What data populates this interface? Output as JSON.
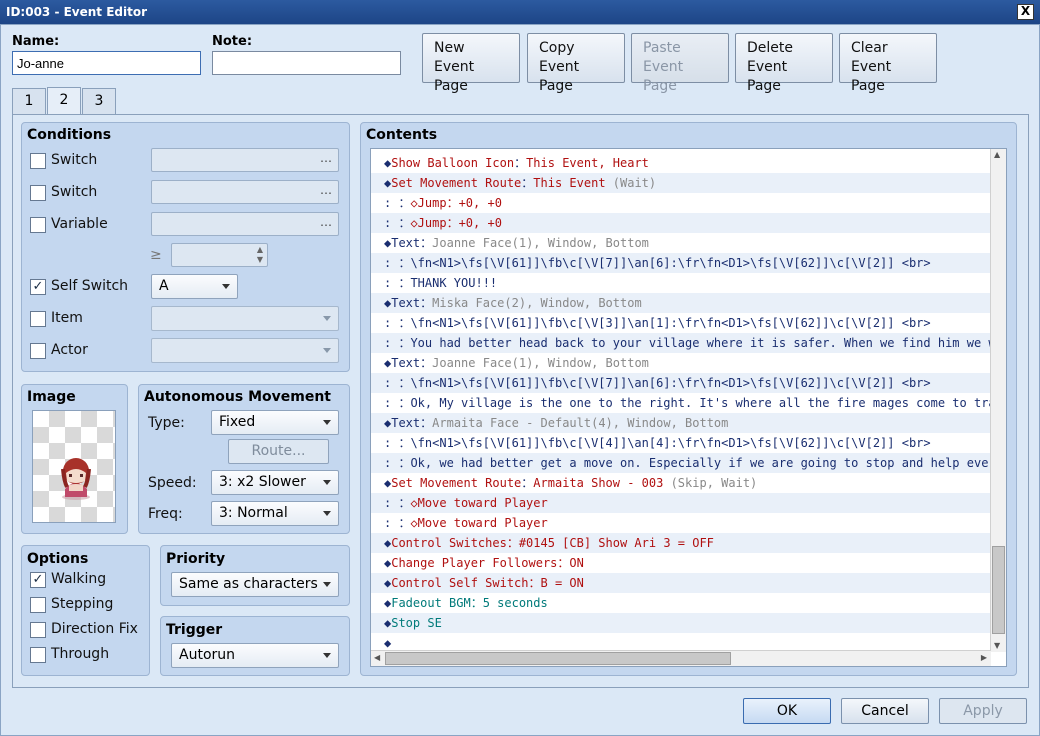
{
  "window": {
    "title": "ID:003 - Event Editor",
    "close": "X"
  },
  "header": {
    "name_label": "Name:",
    "name_value": "Jo-anne",
    "note_label": "Note:",
    "note_value": ""
  },
  "toolbar": [
    {
      "line1": "New",
      "line2": "Event Page",
      "enabled": true
    },
    {
      "line1": "Copy",
      "line2": "Event Page",
      "enabled": true
    },
    {
      "line1": "Paste",
      "line2": "Event Page",
      "enabled": false
    },
    {
      "line1": "Delete",
      "line2": "Event Page",
      "enabled": true
    },
    {
      "line1": "Clear",
      "line2": "Event Page",
      "enabled": true
    }
  ],
  "tabs": [
    "1",
    "2",
    "3"
  ],
  "active_tab": "2",
  "conditions": {
    "title": "Conditions",
    "switch1": {
      "label": "Switch",
      "checked": false,
      "value": "…"
    },
    "switch2": {
      "label": "Switch",
      "checked": false,
      "value": "…"
    },
    "variable": {
      "label": "Variable",
      "checked": false,
      "value": "…",
      "op": "≥"
    },
    "self_switch": {
      "label": "Self Switch",
      "checked": true,
      "value": "A"
    },
    "item": {
      "label": "Item",
      "checked": false
    },
    "actor": {
      "label": "Actor",
      "checked": false
    }
  },
  "image": {
    "title": "Image"
  },
  "movement": {
    "title": "Autonomous Movement",
    "type_label": "Type:",
    "type_value": "Fixed",
    "route_label": "Route...",
    "speed_label": "Speed:",
    "speed_value": "3: x2 Slower",
    "freq_label": "Freq:",
    "freq_value": "3: Normal"
  },
  "options": {
    "title": "Options",
    "items": [
      {
        "label": "Walking",
        "checked": true
      },
      {
        "label": "Stepping",
        "checked": false
      },
      {
        "label": "Direction Fix",
        "checked": false
      },
      {
        "label": "Through",
        "checked": false
      }
    ]
  },
  "priority": {
    "title": "Priority",
    "value": "Same as characters"
  },
  "trigger": {
    "title": "Trigger",
    "value": "Autorun"
  },
  "contents": {
    "title": "Contents",
    "rows": [
      {
        "segs": [
          {
            "t": "◆",
            "c": "navy"
          },
          {
            "t": "Show Balloon Icon",
            "c": "red"
          },
          {
            "t": "：",
            "c": "navy"
          },
          {
            "t": "This Event, Heart",
            "c": "red"
          }
        ]
      },
      {
        "segs": [
          {
            "t": "◆",
            "c": "navy"
          },
          {
            "t": "Set Movement Route",
            "c": "red"
          },
          {
            "t": "：",
            "c": "navy"
          },
          {
            "t": "This Event ",
            "c": "red"
          },
          {
            "t": "(Wait)",
            "c": "gray"
          }
        ]
      },
      {
        "segs": [
          {
            "t": ":                    ：",
            "c": "navy"
          },
          {
            "t": "◇Jump：+0, +0",
            "c": "red"
          }
        ]
      },
      {
        "segs": [
          {
            "t": ":                    ：",
            "c": "navy"
          },
          {
            "t": "◇Jump：+0, +0",
            "c": "red"
          }
        ]
      },
      {
        "segs": [
          {
            "t": "◆",
            "c": "navy"
          },
          {
            "t": "Text",
            "c": "navy"
          },
          {
            "t": "：",
            "c": "navy"
          },
          {
            "t": "Joanne Face(1), Window, Bottom",
            "c": "gray"
          }
        ]
      },
      {
        "segs": [
          {
            "t": ":     ：\\fn<N1>\\fs[\\V[61]]\\fb\\c[\\V[7]]\\an[6]:\\fr\\fn<D1>\\fs[\\V[62]]\\c[\\V[2]] <br>",
            "c": "navy"
          }
        ]
      },
      {
        "segs": [
          {
            "t": ":     ：THANK YOU!!!",
            "c": "navy"
          }
        ]
      },
      {
        "segs": [
          {
            "t": "◆",
            "c": "navy"
          },
          {
            "t": "Text",
            "c": "navy"
          },
          {
            "t": "：",
            "c": "navy"
          },
          {
            "t": "Miska Face(2), Window, Bottom",
            "c": "gray"
          }
        ]
      },
      {
        "segs": [
          {
            "t": ":     ：\\fn<N1>\\fs[\\V[61]]\\fb\\c[\\V[3]]\\an[1]:\\fr\\fn<D1>\\fs[\\V[62]]\\c[\\V[2]] <br>",
            "c": "navy"
          }
        ]
      },
      {
        "segs": [
          {
            "t": ":     ：You had better head back to your village where it is safer. When we find him we wi",
            "c": "navy"
          }
        ]
      },
      {
        "segs": [
          {
            "t": "◆",
            "c": "navy"
          },
          {
            "t": "Text",
            "c": "navy"
          },
          {
            "t": "：",
            "c": "navy"
          },
          {
            "t": "Joanne Face(1), Window, Bottom",
            "c": "gray"
          }
        ]
      },
      {
        "segs": [
          {
            "t": ":     ：\\fn<N1>\\fs[\\V[61]]\\fb\\c[\\V[7]]\\an[6]:\\fr\\fn<D1>\\fs[\\V[62]]\\c[\\V[2]] <br>",
            "c": "navy"
          }
        ]
      },
      {
        "segs": [
          {
            "t": ":     ：Ok, My village is the one to the right. It's where all the fire mages come to trai",
            "c": "navy"
          }
        ]
      },
      {
        "segs": [
          {
            "t": "◆",
            "c": "navy"
          },
          {
            "t": "Text",
            "c": "navy"
          },
          {
            "t": "：",
            "c": "navy"
          },
          {
            "t": "Armaita Face - Default(4), Window, Bottom",
            "c": "gray"
          }
        ]
      },
      {
        "segs": [
          {
            "t": ":     ：\\fn<N1>\\fs[\\V[61]]\\fb\\c[\\V[4]]\\an[4]:\\fr\\fn<D1>\\fs[\\V[62]]\\c[\\V[2]] <br>",
            "c": "navy"
          }
        ]
      },
      {
        "segs": [
          {
            "t": ":     ：Ok, we had better get a move on. Especially if we are going to stop and help every",
            "c": "navy"
          }
        ]
      },
      {
        "segs": [
          {
            "t": "◆",
            "c": "navy"
          },
          {
            "t": "Set Movement Route",
            "c": "red"
          },
          {
            "t": "：",
            "c": "navy"
          },
          {
            "t": "Armaita Show - 003 ",
            "c": "red"
          },
          {
            "t": "(Skip, Wait)",
            "c": "gray"
          }
        ]
      },
      {
        "segs": [
          {
            "t": ":                    ：",
            "c": "navy"
          },
          {
            "t": "◇Move toward Player",
            "c": "red"
          }
        ]
      },
      {
        "segs": [
          {
            "t": ":                    ：",
            "c": "navy"
          },
          {
            "t": "◇Move toward Player",
            "c": "red"
          }
        ]
      },
      {
        "segs": [
          {
            "t": "◆",
            "c": "navy"
          },
          {
            "t": "Control Switches：#0145 [CB] Show Ari 3 = OFF",
            "c": "red"
          }
        ]
      },
      {
        "segs": [
          {
            "t": "◆",
            "c": "navy"
          },
          {
            "t": "Change Player Followers：ON",
            "c": "red"
          }
        ]
      },
      {
        "segs": [
          {
            "t": "◆",
            "c": "navy"
          },
          {
            "t": "Control Self Switch：B = ON",
            "c": "red"
          }
        ]
      },
      {
        "segs": [
          {
            "t": "◆",
            "c": "navy"
          },
          {
            "t": "Fadeout BGM：5 seconds",
            "c": "teal"
          }
        ]
      },
      {
        "segs": [
          {
            "t": "◆",
            "c": "navy"
          },
          {
            "t": "Stop SE",
            "c": "teal"
          }
        ]
      },
      {
        "segs": [
          {
            "t": "◆",
            "c": "navy"
          }
        ]
      }
    ]
  },
  "footer": {
    "ok": "OK",
    "cancel": "Cancel",
    "apply": "Apply"
  }
}
